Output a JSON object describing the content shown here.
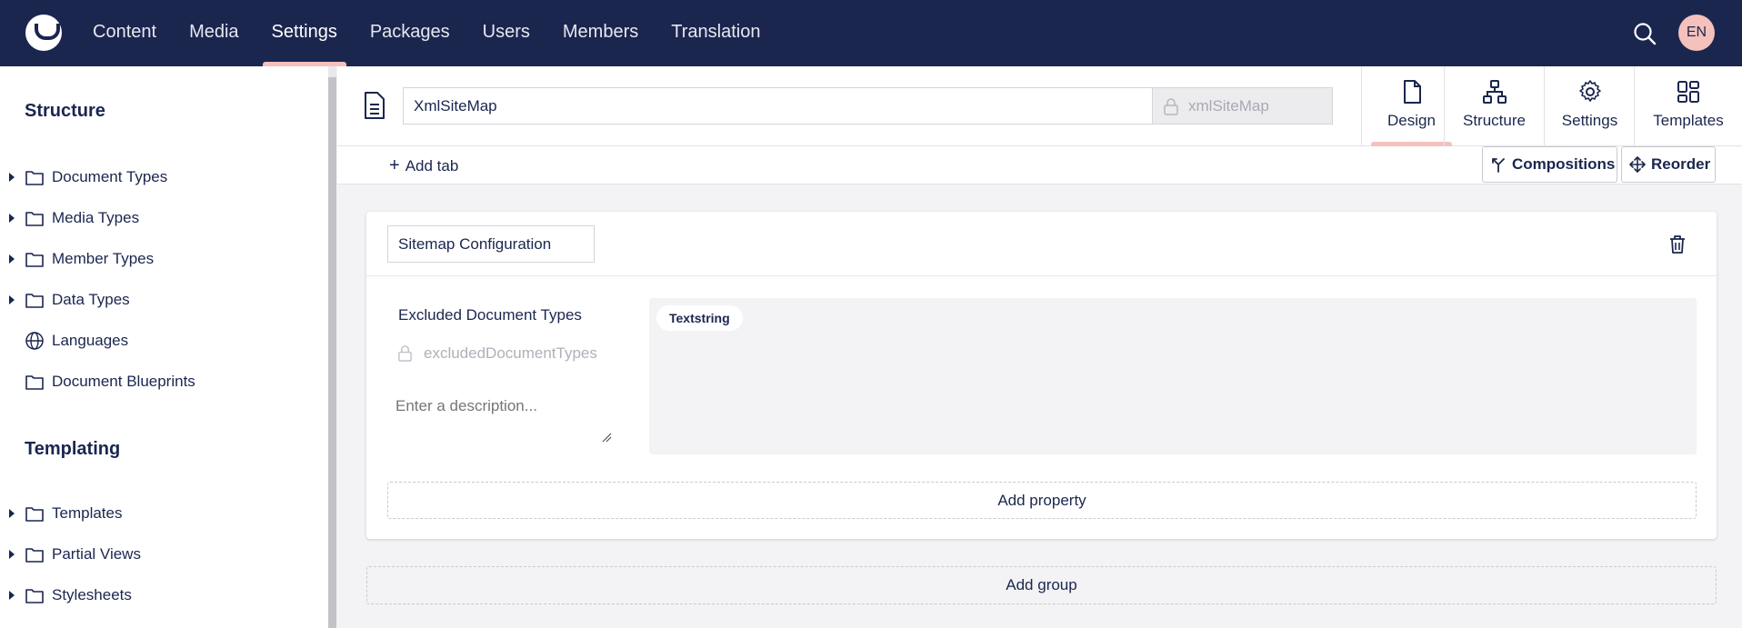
{
  "topbar": {
    "nav": [
      "Content",
      "Media",
      "Settings",
      "Packages",
      "Users",
      "Members",
      "Translation"
    ],
    "active_nav": "Settings",
    "user_initials": "EN"
  },
  "sidebar": {
    "structure_title": "Structure",
    "structure_items": [
      {
        "label": "Document Types",
        "icon": "folder-icon",
        "expandable": true
      },
      {
        "label": "Media Types",
        "icon": "folder-icon",
        "expandable": true
      },
      {
        "label": "Member Types",
        "icon": "folder-icon",
        "expandable": true
      },
      {
        "label": "Data Types",
        "icon": "folder-icon",
        "expandable": true
      },
      {
        "label": "Languages",
        "icon": "globe-icon",
        "expandable": false
      },
      {
        "label": "Document Blueprints",
        "icon": "folder-icon",
        "expandable": false
      }
    ],
    "templating_title": "Templating",
    "templating_items": [
      {
        "label": "Templates",
        "icon": "folder-icon",
        "expandable": true
      },
      {
        "label": "Partial Views",
        "icon": "folder-icon",
        "expandable": true
      },
      {
        "label": "Stylesheets",
        "icon": "folder-icon",
        "expandable": true
      }
    ]
  },
  "editor": {
    "name": "XmlSiteMap",
    "alias": "xmlSiteMap",
    "views": [
      {
        "label": "Design",
        "icon": "document-icon",
        "active": true
      },
      {
        "label": "Structure",
        "icon": "sitemap-icon",
        "active": false
      },
      {
        "label": "Settings",
        "icon": "gear-icon",
        "active": false
      },
      {
        "label": "Templates",
        "icon": "grid-icon",
        "active": false
      }
    ],
    "add_tab_label": "Add tab",
    "compositions_label": "Compositions",
    "reorder_label": "Reorder"
  },
  "group": {
    "name": "Sitemap Configuration",
    "property": {
      "label": "Excluded Document Types",
      "alias": "excludedDocumentTypes",
      "description_placeholder": "Enter a description...",
      "editor": "Textstring"
    },
    "add_property_label": "Add property"
  },
  "add_group_label": "Add group",
  "colors": {
    "topbar": "#1b264f",
    "accent": "#f5c1bc",
    "background": "#f3f3f5"
  }
}
